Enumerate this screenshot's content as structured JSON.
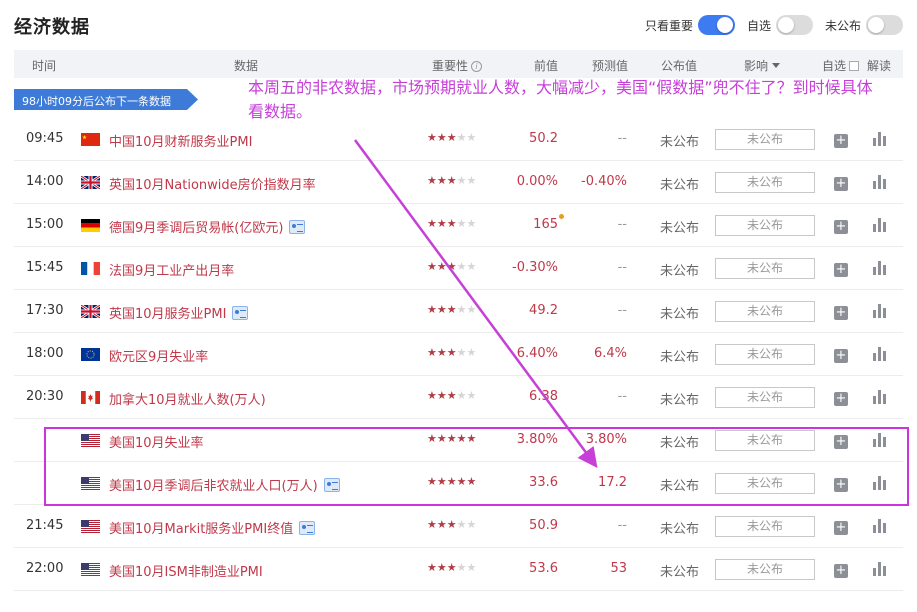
{
  "header": {
    "title": "经济数据",
    "toggles": [
      {
        "label": "只看重要",
        "on": true
      },
      {
        "label": "自选",
        "on": false
      },
      {
        "label": "未公布",
        "on": false
      }
    ]
  },
  "columns": {
    "time": "时间",
    "data": "数据",
    "importance": "重要性",
    "previous": "前值",
    "forecast": "预测值",
    "actual": "公布值",
    "impact": "影响",
    "watch": "自选",
    "explain": "解读"
  },
  "banner": "98小时09分后公布下一条数据",
  "annotation": "本周五的非农数据，市场预期就业人数，大幅减少，美国“假数据”兜不住了？到时候具体看数据。",
  "rows": [
    {
      "time": "09:45",
      "country": "cn",
      "name": "中国10月财新服务业PMI",
      "doc": false,
      "stars": 3,
      "prev": "50.2",
      "forecast": "--",
      "actual": "未公布",
      "impact": "未公布"
    },
    {
      "time": "14:00",
      "country": "uk",
      "name": "英国10月Nationwide房价指数月率",
      "doc": false,
      "stars": 3,
      "prev": "0.00%",
      "forecast": "-0.40%",
      "actual": "未公布",
      "impact": "未公布"
    },
    {
      "time": "15:00",
      "country": "de",
      "name": "德国9月季调后贸易帐(亿欧元)",
      "doc": true,
      "stars": 3,
      "prev": "165",
      "forecast": "--",
      "actual": "未公布",
      "impact": "未公布"
    },
    {
      "time": "15:45",
      "country": "fr",
      "name": "法国9月工业产出月率",
      "doc": false,
      "stars": 3,
      "prev": "-0.30%",
      "forecast": "--",
      "actual": "未公布",
      "impact": "未公布"
    },
    {
      "time": "17:30",
      "country": "uk",
      "name": "英国10月服务业PMI",
      "doc": true,
      "stars": 3,
      "prev": "49.2",
      "forecast": "--",
      "actual": "未公布",
      "impact": "未公布"
    },
    {
      "time": "18:00",
      "country": "eu",
      "name": "欧元区9月失业率",
      "doc": false,
      "stars": 3,
      "prev": "6.40%",
      "forecast": "6.4%",
      "actual": "未公布",
      "impact": "未公布"
    },
    {
      "time": "20:30",
      "country": "ca",
      "name": "加拿大10月就业人数(万人)",
      "doc": false,
      "stars": 3,
      "prev": "6.38",
      "forecast": "--",
      "actual": "未公布",
      "impact": "未公布"
    },
    {
      "time": "",
      "country": "us",
      "name": "美国10月失业率",
      "doc": false,
      "stars": 5,
      "prev": "3.80%",
      "forecast": "3.80%",
      "actual": "未公布",
      "impact": "未公布"
    },
    {
      "time": "",
      "country": "us",
      "name": "美国10月季调后非农就业人口(万人)",
      "doc": true,
      "stars": 5,
      "prev": "33.6",
      "forecast": "17.2",
      "actual": "未公布",
      "impact": "未公布"
    },
    {
      "time": "21:45",
      "country": "us",
      "name": "美国10月Markit服务业PMI终值",
      "doc": true,
      "stars": 3,
      "prev": "50.9",
      "forecast": "--",
      "actual": "未公布",
      "impact": "未公布"
    },
    {
      "time": "22:00",
      "country": "us",
      "name": "美国10月ISM非制造业PMI",
      "doc": false,
      "stars": 3,
      "prev": "53.6",
      "forecast": "53",
      "actual": "未公布",
      "impact": "未公布"
    }
  ],
  "colors": {
    "accent": "#3d7bf0",
    "name_text": "#c0394a",
    "star": "#b03c47",
    "annotation": "#c640d8"
  }
}
